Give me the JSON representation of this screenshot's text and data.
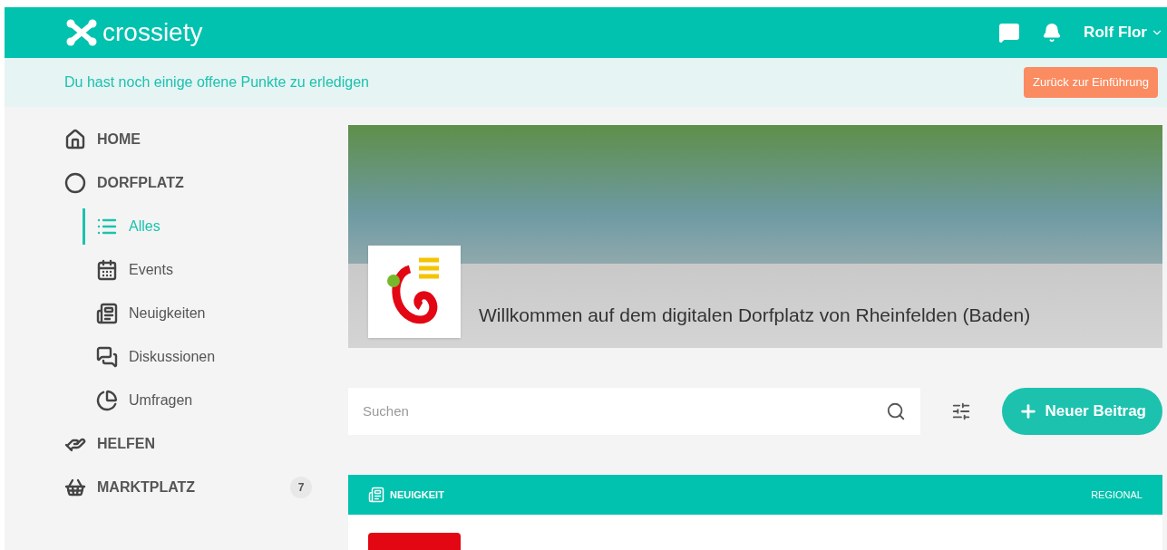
{
  "header": {
    "brand": "crossiety",
    "user": "Rolf Flor"
  },
  "notice": {
    "text": "Du hast noch einige offene Punkte zu erledigen",
    "button": "Zurück zur Einführung"
  },
  "sidebar": {
    "items": [
      {
        "kind": "main",
        "label": "HOME",
        "selected": false
      },
      {
        "kind": "main",
        "label": "DORFPLATZ",
        "selected": false
      },
      {
        "kind": "sub",
        "label": "Alles",
        "selected": true
      },
      {
        "kind": "sub",
        "label": "Events",
        "selected": false
      },
      {
        "kind": "sub",
        "label": "Neuigkeiten",
        "selected": false
      },
      {
        "kind": "sub",
        "label": "Diskussionen",
        "selected": false
      },
      {
        "kind": "sub",
        "label": "Umfragen",
        "selected": false
      },
      {
        "kind": "main",
        "label": "HELFEN",
        "selected": false
      },
      {
        "kind": "main",
        "label": "MARKTPLATZ",
        "selected": false,
        "badge": "7"
      }
    ]
  },
  "banner": {
    "title": "Willkommen auf dem digitalen Dorfplatz von Rheinfelden (Baden)"
  },
  "search": {
    "placeholder": "Suchen"
  },
  "new_post_button": "Neuer Beitrag",
  "post": {
    "type": "NEUIGKEIT",
    "scope": "REGIONAL"
  }
}
